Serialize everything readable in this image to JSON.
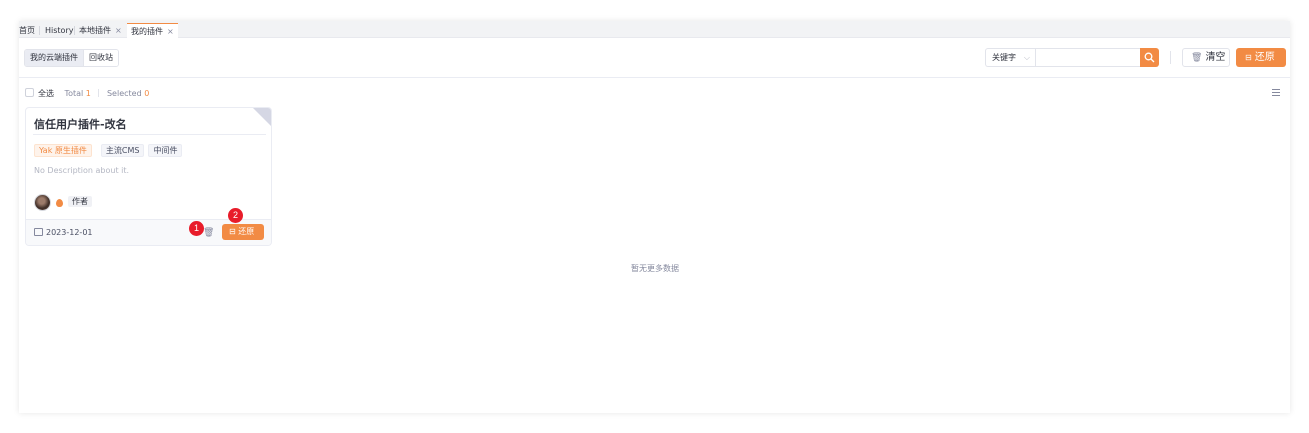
{
  "tabs": [
    {
      "label": "首页",
      "closable": false
    },
    {
      "label": "History",
      "closable": false
    },
    {
      "label": "本地插件",
      "closable": true
    },
    {
      "label": "我的插件",
      "closable": true,
      "active": true
    }
  ],
  "tab_close_glyph": "×",
  "toolbar": {
    "segments": [
      "我的云端插件",
      "回收站"
    ],
    "keyword_select": "关键字",
    "search_input_value": "",
    "clear_label": "清空",
    "restore_label": "还原"
  },
  "list_header": {
    "select_all": "全选",
    "total_label": "Total",
    "total_value": "1",
    "selected_label": "Selected",
    "selected_value": "0"
  },
  "card": {
    "title": "信任用户插件-改名",
    "tags": [
      "Yak 原生插件",
      "主流CMS",
      "中间件"
    ],
    "description": "No Description about it.",
    "author_tag": "作者",
    "date": "2023-12-01",
    "restore_label": "还原"
  },
  "markers": [
    "1",
    "2"
  ],
  "empty_text": "暂无更多数据",
  "colors": {
    "accent": "#f28b44",
    "marker": "#e81c2a"
  }
}
